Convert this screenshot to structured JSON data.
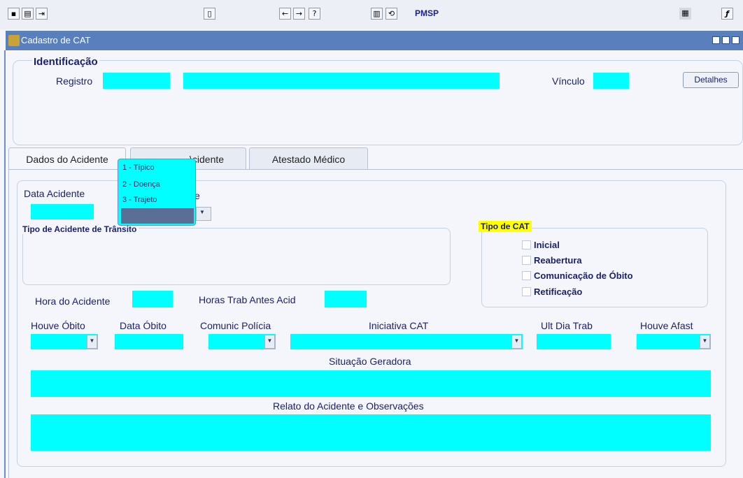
{
  "toolbar": {
    "icons": [
      "save-icon",
      "delete-icon",
      "exit-icon",
      "clipboard-icon",
      "previous-icon",
      "next-icon",
      "help-icon",
      "print-icon",
      "refresh-icon",
      "grid-icon",
      "function-icon"
    ],
    "pmsp_label": "PMSP",
    "function_glyph": "ƒ"
  },
  "window": {
    "title": "Cadastro de CAT"
  },
  "identificacao": {
    "title": "Identificação",
    "registro_label": "Registro",
    "vinculo_label": "Vínculo",
    "detalhes_button": "Detalhes"
  },
  "tabs": [
    {
      "label": "Dados do Acidente",
      "active": true
    },
    {
      "label": "Local do Acidente",
      "visible_label": "\\cidente",
      "active": false
    },
    {
      "label": "Atestado Médico",
      "active": false
    }
  ],
  "form": {
    "data_acidente_label": "Data Acidente",
    "tipo_label_partial": "e",
    "tipo_transito_title": "Tipo de Acidente de Trânsito",
    "hora_acidente_label": "Hora do Acidente",
    "horas_trab_label": "Horas Trab Antes Acid",
    "houve_obito_label": "Houve Óbito",
    "data_obito_label": "Data Óbito",
    "comunic_policia_label": "Comunic Polícia",
    "iniciativa_cat_label": "Iniciativa CAT",
    "ult_dia_trab_label": "Ult Dia Trab",
    "houve_afast_label": "Houve Afast",
    "situacao_geradora_label": "Situação Geradora",
    "relato_label": "Relato do Acidente e Observações"
  },
  "tipo_cat": {
    "title": "Tipo de CAT",
    "options": [
      "Inicial",
      "Reabertura",
      "Comunicação de Óbito",
      "Retificação"
    ]
  },
  "popup_list": {
    "items": [
      "1 - Típico",
      "2 - Doença",
      "3 - Trajeto"
    ]
  },
  "colors": {
    "field": "#00ffff",
    "label_text": "#1a1f6e",
    "titlebar": "#5a7fbd",
    "highlight": "#ffff00"
  }
}
